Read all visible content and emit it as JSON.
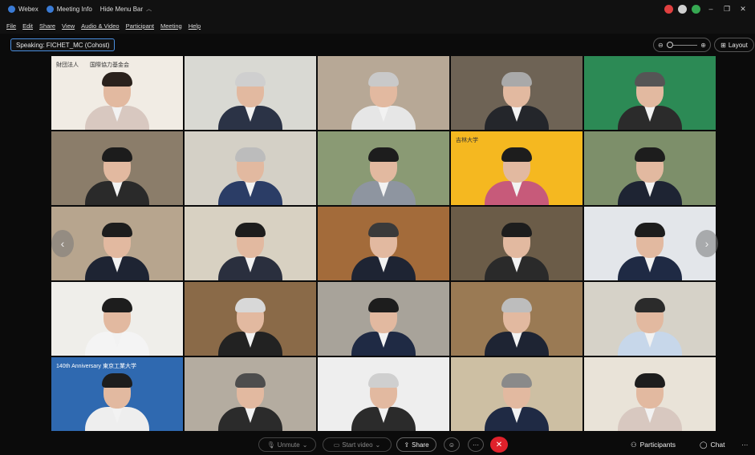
{
  "titlebar": {
    "app": "Webex",
    "meeting_info": "Meeting Info",
    "hide_menu": "Hide Menu Bar",
    "colors": {
      "red": "#e04040",
      "gray": "#cfcfcf",
      "green": "#36a852"
    },
    "minimize": "–",
    "restore": "❐",
    "close": "✕"
  },
  "menu": [
    "File",
    "Edit",
    "Share",
    "View",
    "Audio & Video",
    "Participant",
    "Meeting",
    "Help"
  ],
  "speaking": "Speaking: FICHET_MC (Cohost)",
  "zoom": {
    "minus": "⊖",
    "plus": "⊕"
  },
  "layout_label": "Layout",
  "tiles": [
    {
      "bg": "#f1ece4",
      "hair": "#2a211c",
      "shirt": "#d8c8c0",
      "text": "財団法人　　国際協力基金会"
    },
    {
      "bg": "#d9d9d3",
      "hair": "#cfcfcf",
      "shirt": "#2b3346"
    },
    {
      "bg": "#b7a896",
      "hair": "#c9c9c9",
      "shirt": "#e6e6e6"
    },
    {
      "bg": "#6e6355",
      "hair": "#a9a9a9",
      "shirt": "#24262b"
    },
    {
      "bg": "#2c8a55",
      "hair": "#555",
      "shirt": "#2b2b2b"
    },
    {
      "bg": "#8b7d6a",
      "hair": "#1c1c1c",
      "shirt": "#2a2a2a"
    },
    {
      "bg": "#d4d0c6",
      "hair": "#bcbcbc",
      "shirt": "#2b3d66"
    },
    {
      "bg": "#8a9a74",
      "hair": "#1d1d1d",
      "shirt": "#8e95a0"
    },
    {
      "bg": "#f5b820",
      "hair": "#1d1d1d",
      "shirt": "#c75a7a",
      "text": "吉林大学"
    },
    {
      "bg": "#7d8f6a",
      "hair": "#1d1d1d",
      "shirt": "#1e2433"
    },
    {
      "bg": "#b7a58e",
      "hair": "#1d1d1d",
      "shirt": "#1e2433"
    },
    {
      "bg": "#d8d1c2",
      "hair": "#1d1d1d",
      "shirt": "#2a2f3e"
    },
    {
      "bg": "#a36b3a",
      "hair": "#3a3a3a",
      "shirt": "#1e2433"
    },
    {
      "bg": "#6b5c48",
      "hair": "#1d1d1d",
      "shirt": "#2a2a2a"
    },
    {
      "bg": "#e3e6ea",
      "hair": "#1d1d1d",
      "shirt": "#1f2a44"
    },
    {
      "bg": "#efeeea",
      "hair": "#1d1d1d",
      "shirt": "#f4f4f4"
    },
    {
      "bg": "#8a6a48",
      "hair": "#d8d8d8",
      "shirt": "#222"
    },
    {
      "bg": "#a8a39a",
      "hair": "#1d1d1d",
      "shirt": "#1f2a44"
    },
    {
      "bg": "#9a7a54",
      "hair": "#bdbdbd",
      "shirt": "#1e2433"
    },
    {
      "bg": "#d6d2c8",
      "hair": "#2b2b2b",
      "shirt": "#c7d7ea"
    },
    {
      "bg": "#2f69b0",
      "hair": "#1d1d1d",
      "shirt": "#eee",
      "text": "140th Anniversary  東京工業大学"
    },
    {
      "bg": "#b4aca0",
      "hair": "#4d4d4d",
      "shirt": "#2b2b2b"
    },
    {
      "bg": "#eeeeee",
      "hair": "#cfcfcf",
      "shirt": "#2b2b2b"
    },
    {
      "bg": "#cdbfa3",
      "hair": "#8a8a8a",
      "shirt": "#1f2a44"
    },
    {
      "bg": "#e9e3d8",
      "hair": "#1d1d1d",
      "shirt": "#d8c8c0"
    }
  ],
  "nav": {
    "prev": "‹",
    "next": "›"
  },
  "toolbar": {
    "unmute": "Unmute",
    "start_video": "Start video",
    "share": "Share",
    "reactions": "☺",
    "more": "···",
    "end": "✕",
    "participants": "Participants",
    "chat": "Chat",
    "more_right": "···"
  }
}
